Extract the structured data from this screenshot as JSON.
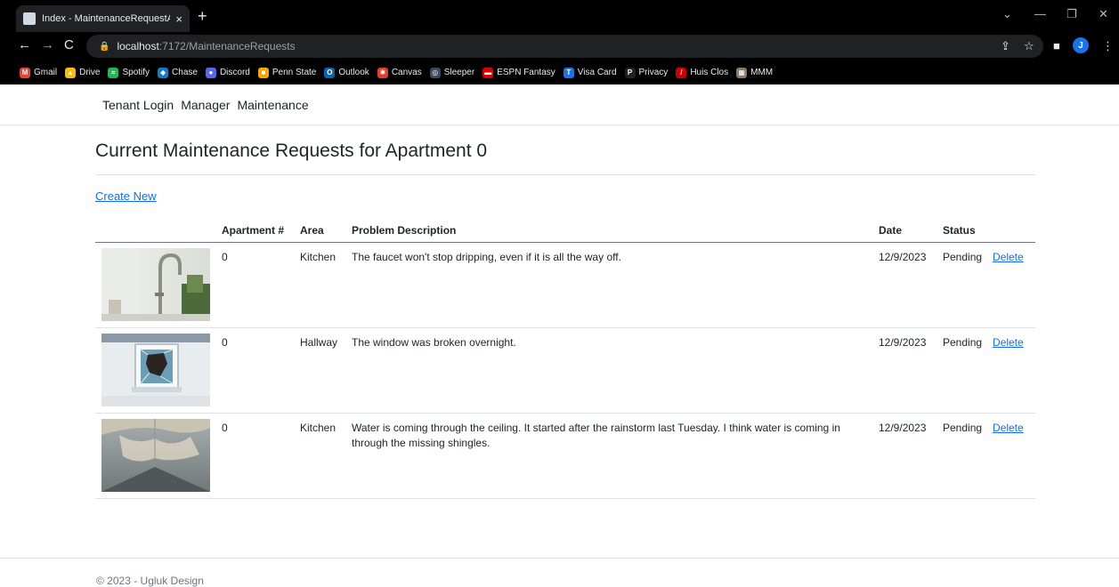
{
  "browser": {
    "tab_title": "Index - MaintenanceRequestApp",
    "tab_close": "×",
    "new_tab": "+",
    "url_host": "localhost",
    "url_path": ":7172/MaintenanceRequests",
    "avatar_letter": "J",
    "bookmarks": [
      {
        "label": "Gmail",
        "icon": "gmail-icon",
        "color": "#ea4335",
        "glyph": "M"
      },
      {
        "label": "Drive",
        "icon": "drive-icon",
        "color": "#fbbc04",
        "glyph": "▲"
      },
      {
        "label": "Spotify",
        "icon": "spotify-icon",
        "color": "#1db954",
        "glyph": "≈"
      },
      {
        "label": "Chase",
        "icon": "chase-icon",
        "color": "#117aca",
        "glyph": "◆"
      },
      {
        "label": "Discord",
        "icon": "discord-icon",
        "color": "#5865f2",
        "glyph": "●"
      },
      {
        "label": "Penn State",
        "icon": "pennstate-icon",
        "color": "#f7a800",
        "glyph": "■"
      },
      {
        "label": "Outlook",
        "icon": "outlook-icon",
        "color": "#0a64ad",
        "glyph": "O"
      },
      {
        "label": "Canvas",
        "icon": "canvas-icon",
        "color": "#e13f2b",
        "glyph": "✱"
      },
      {
        "label": "Sleeper",
        "icon": "sleeper-icon",
        "color": "#3b4a5c",
        "glyph": "◎"
      },
      {
        "label": "ESPN Fantasy",
        "icon": "espn-icon",
        "color": "#d00",
        "glyph": "▬"
      },
      {
        "label": "Visa Card",
        "icon": "visa-icon",
        "color": "#1a73e8",
        "glyph": "T"
      },
      {
        "label": "Privacy",
        "icon": "privacy-icon",
        "color": "#222",
        "glyph": "P"
      },
      {
        "label": "Huis Clos",
        "icon": "huisclos-icon",
        "color": "#c00",
        "glyph": "/"
      },
      {
        "label": "MMM",
        "icon": "mmm-icon",
        "color": "#8a7a6a",
        "glyph": "▦"
      }
    ]
  },
  "nav": {
    "tenant_login": "Tenant Login",
    "manager": "Manager",
    "maintenance": "Maintenance"
  },
  "page": {
    "title": "Current Maintenance Requests for Apartment 0",
    "create_new": "Create New"
  },
  "table": {
    "headers": {
      "apartment": "Apartment #",
      "area": "Area",
      "problem": "Problem Description",
      "date": "Date",
      "status": "Status"
    },
    "rows": [
      {
        "apartment": "0",
        "area": "Kitchen",
        "problem": "The faucet won't stop dripping, even if it is all the way off.",
        "date": "12/9/2023",
        "status": "Pending",
        "action": "Delete",
        "image": "faucet-photo"
      },
      {
        "apartment": "0",
        "area": "Hallway",
        "problem": "The window was broken overnight.",
        "date": "12/9/2023",
        "status": "Pending",
        "action": "Delete",
        "image": "broken-window-photo"
      },
      {
        "apartment": "0",
        "area": "Kitchen",
        "problem": "Water is coming through the ceiling. It started after the rainstorm last Tuesday. I think water is coming in through the missing shingles.",
        "date": "12/9/2023",
        "status": "Pending",
        "action": "Delete",
        "image": "ceiling-leak-photo"
      }
    ]
  },
  "footer": {
    "text": "© 2023 - Ugluk Design"
  }
}
